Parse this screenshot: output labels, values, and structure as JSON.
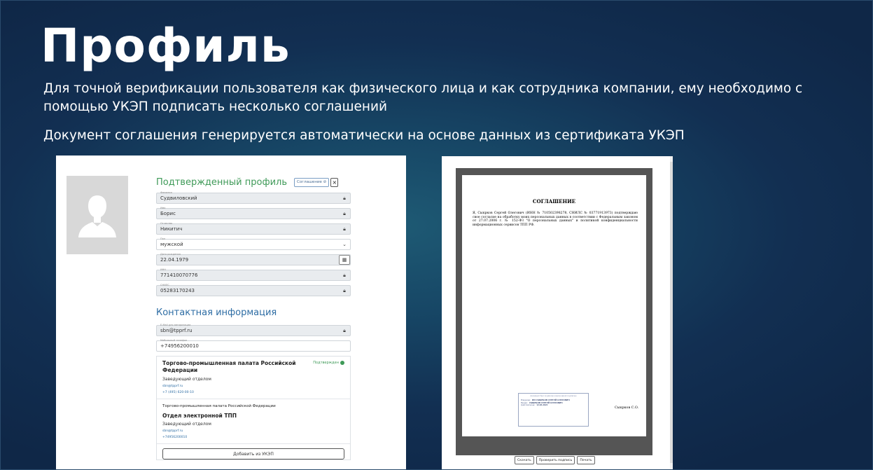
{
  "slide": {
    "title": "Профиль",
    "description": "Для точной верификации пользователя как физического лица и как сотрудника компании, ему необходимо с помощью УКЭП подписать несколько соглашений",
    "description2": "Документ соглашения генерируется автоматически на основе данных из сертификата УКЭП"
  },
  "profile": {
    "section_title": "Подтвержденный профиль",
    "agreement_chip": "Соглашение ⊘",
    "agreement_close": "×",
    "fields": [
      {
        "label": "Фамилия",
        "value": "Судвиловский",
        "icon": "lock-icon"
      },
      {
        "label": "Имя",
        "value": "Борис",
        "icon": "lock-icon"
      },
      {
        "label": "Отчество",
        "value": "Никитич",
        "icon": "lock-icon"
      },
      {
        "label": "Пол",
        "value": "мужской",
        "icon": "chevron-down-icon"
      },
      {
        "label": "Дата рождения",
        "value": "22.04.1979",
        "icon": "calendar-icon"
      },
      {
        "label": "ИНН",
        "value": "771410070776",
        "icon": "lock-icon"
      },
      {
        "label": "СНИЛС",
        "value": "05283170243",
        "icon": "lock-icon"
      }
    ],
    "contacts_title": "Контактная информация",
    "email": {
      "label": "E-Mail для авторизации",
      "value": "sbn@tpprf.ru"
    },
    "phone": {
      "label": "Мобильный телефон",
      "value": "+74956200010"
    },
    "orgs": [
      {
        "name": "Торгово-промышленная палата Российской Федерации",
        "status": "Подтвержден",
        "role": "Заведующий отделом",
        "email": "sbn@tpprf.ru",
        "phone": "+7 (495) 620-00-10"
      },
      {
        "name": "Торгово-промышленная палата Российской Федерации",
        "department": "Отдел электронной ТПП",
        "role": "Заведующий отделом",
        "email": "sbn@tpprf.ru",
        "phone": "+74956200010"
      }
    ],
    "add_button": "Добавить из УКЭП"
  },
  "document": {
    "heading": "СОГЛАШЕНИЕ",
    "body": "Я, Сыкрков Сергей Олегович (ИНН № 710502398278, СНИЛС № 03771913973) подтверждаю свое согласие на обработку моих персональных данных в соответствии с Федеральным законом от 27.07.2006 г. № 152-ФЗ \"О персональных данных\" и политикой конфиденциальности информационных сервисов ТПП РФ.",
    "stamp_head": "Документ был подписан электронной подписью",
    "stamp_rows": [
      {
        "k": "Владелец:",
        "v": "ИП СЫКРКОВ СЕРГЕЙ ОЛЕГОВИЧ"
      },
      {
        "k": "Выдан:",
        "v": "СЫКРКОВ СЕРГЕЙ ОЛЕГОВИЧ"
      },
      {
        "k": "Действителен:",
        "v": "12.03.2021"
      }
    ],
    "signer": "Сыкрков С.О.",
    "buttons": {
      "download": "Скачать",
      "verify": "Проверить подпись",
      "print": "Печать"
    }
  },
  "colors": {
    "green": "#3f9a58",
    "blue": "#2e6da4",
    "bg_dark": "#0f2747"
  }
}
